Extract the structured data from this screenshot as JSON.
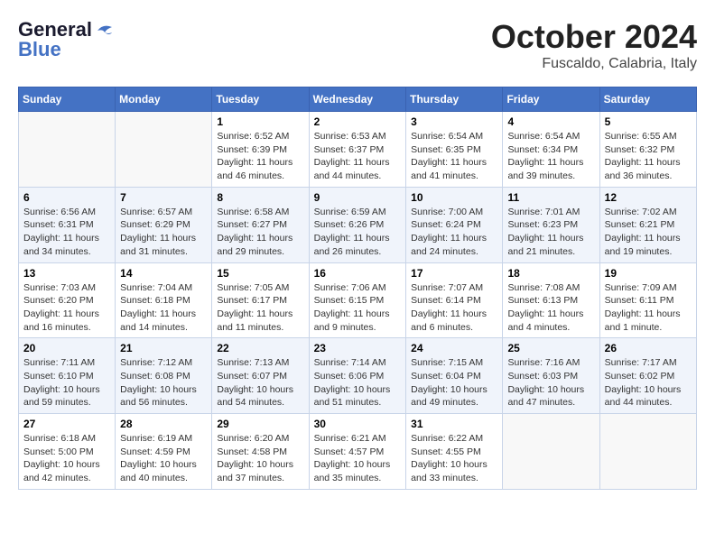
{
  "header": {
    "logo_general": "General",
    "logo_blue": "Blue",
    "month_title": "October 2024",
    "location": "Fuscaldo, Calabria, Italy"
  },
  "days_of_week": [
    "Sunday",
    "Monday",
    "Tuesday",
    "Wednesday",
    "Thursday",
    "Friday",
    "Saturday"
  ],
  "weeks": [
    [
      {
        "day": "",
        "info": ""
      },
      {
        "day": "",
        "info": ""
      },
      {
        "day": "1",
        "info": "Sunrise: 6:52 AM\nSunset: 6:39 PM\nDaylight: 11 hours and 46 minutes."
      },
      {
        "day": "2",
        "info": "Sunrise: 6:53 AM\nSunset: 6:37 PM\nDaylight: 11 hours and 44 minutes."
      },
      {
        "day": "3",
        "info": "Sunrise: 6:54 AM\nSunset: 6:35 PM\nDaylight: 11 hours and 41 minutes."
      },
      {
        "day": "4",
        "info": "Sunrise: 6:54 AM\nSunset: 6:34 PM\nDaylight: 11 hours and 39 minutes."
      },
      {
        "day": "5",
        "info": "Sunrise: 6:55 AM\nSunset: 6:32 PM\nDaylight: 11 hours and 36 minutes."
      }
    ],
    [
      {
        "day": "6",
        "info": "Sunrise: 6:56 AM\nSunset: 6:31 PM\nDaylight: 11 hours and 34 minutes."
      },
      {
        "day": "7",
        "info": "Sunrise: 6:57 AM\nSunset: 6:29 PM\nDaylight: 11 hours and 31 minutes."
      },
      {
        "day": "8",
        "info": "Sunrise: 6:58 AM\nSunset: 6:27 PM\nDaylight: 11 hours and 29 minutes."
      },
      {
        "day": "9",
        "info": "Sunrise: 6:59 AM\nSunset: 6:26 PM\nDaylight: 11 hours and 26 minutes."
      },
      {
        "day": "10",
        "info": "Sunrise: 7:00 AM\nSunset: 6:24 PM\nDaylight: 11 hours and 24 minutes."
      },
      {
        "day": "11",
        "info": "Sunrise: 7:01 AM\nSunset: 6:23 PM\nDaylight: 11 hours and 21 minutes."
      },
      {
        "day": "12",
        "info": "Sunrise: 7:02 AM\nSunset: 6:21 PM\nDaylight: 11 hours and 19 minutes."
      }
    ],
    [
      {
        "day": "13",
        "info": "Sunrise: 7:03 AM\nSunset: 6:20 PM\nDaylight: 11 hours and 16 minutes."
      },
      {
        "day": "14",
        "info": "Sunrise: 7:04 AM\nSunset: 6:18 PM\nDaylight: 11 hours and 14 minutes."
      },
      {
        "day": "15",
        "info": "Sunrise: 7:05 AM\nSunset: 6:17 PM\nDaylight: 11 hours and 11 minutes."
      },
      {
        "day": "16",
        "info": "Sunrise: 7:06 AM\nSunset: 6:15 PM\nDaylight: 11 hours and 9 minutes."
      },
      {
        "day": "17",
        "info": "Sunrise: 7:07 AM\nSunset: 6:14 PM\nDaylight: 11 hours and 6 minutes."
      },
      {
        "day": "18",
        "info": "Sunrise: 7:08 AM\nSunset: 6:13 PM\nDaylight: 11 hours and 4 minutes."
      },
      {
        "day": "19",
        "info": "Sunrise: 7:09 AM\nSunset: 6:11 PM\nDaylight: 11 hours and 1 minute."
      }
    ],
    [
      {
        "day": "20",
        "info": "Sunrise: 7:11 AM\nSunset: 6:10 PM\nDaylight: 10 hours and 59 minutes."
      },
      {
        "day": "21",
        "info": "Sunrise: 7:12 AM\nSunset: 6:08 PM\nDaylight: 10 hours and 56 minutes."
      },
      {
        "day": "22",
        "info": "Sunrise: 7:13 AM\nSunset: 6:07 PM\nDaylight: 10 hours and 54 minutes."
      },
      {
        "day": "23",
        "info": "Sunrise: 7:14 AM\nSunset: 6:06 PM\nDaylight: 10 hours and 51 minutes."
      },
      {
        "day": "24",
        "info": "Sunrise: 7:15 AM\nSunset: 6:04 PM\nDaylight: 10 hours and 49 minutes."
      },
      {
        "day": "25",
        "info": "Sunrise: 7:16 AM\nSunset: 6:03 PM\nDaylight: 10 hours and 47 minutes."
      },
      {
        "day": "26",
        "info": "Sunrise: 7:17 AM\nSunset: 6:02 PM\nDaylight: 10 hours and 44 minutes."
      }
    ],
    [
      {
        "day": "27",
        "info": "Sunrise: 6:18 AM\nSunset: 5:00 PM\nDaylight: 10 hours and 42 minutes."
      },
      {
        "day": "28",
        "info": "Sunrise: 6:19 AM\nSunset: 4:59 PM\nDaylight: 10 hours and 40 minutes."
      },
      {
        "day": "29",
        "info": "Sunrise: 6:20 AM\nSunset: 4:58 PM\nDaylight: 10 hours and 37 minutes."
      },
      {
        "day": "30",
        "info": "Sunrise: 6:21 AM\nSunset: 4:57 PM\nDaylight: 10 hours and 35 minutes."
      },
      {
        "day": "31",
        "info": "Sunrise: 6:22 AM\nSunset: 4:55 PM\nDaylight: 10 hours and 33 minutes."
      },
      {
        "day": "",
        "info": ""
      },
      {
        "day": "",
        "info": ""
      }
    ]
  ]
}
